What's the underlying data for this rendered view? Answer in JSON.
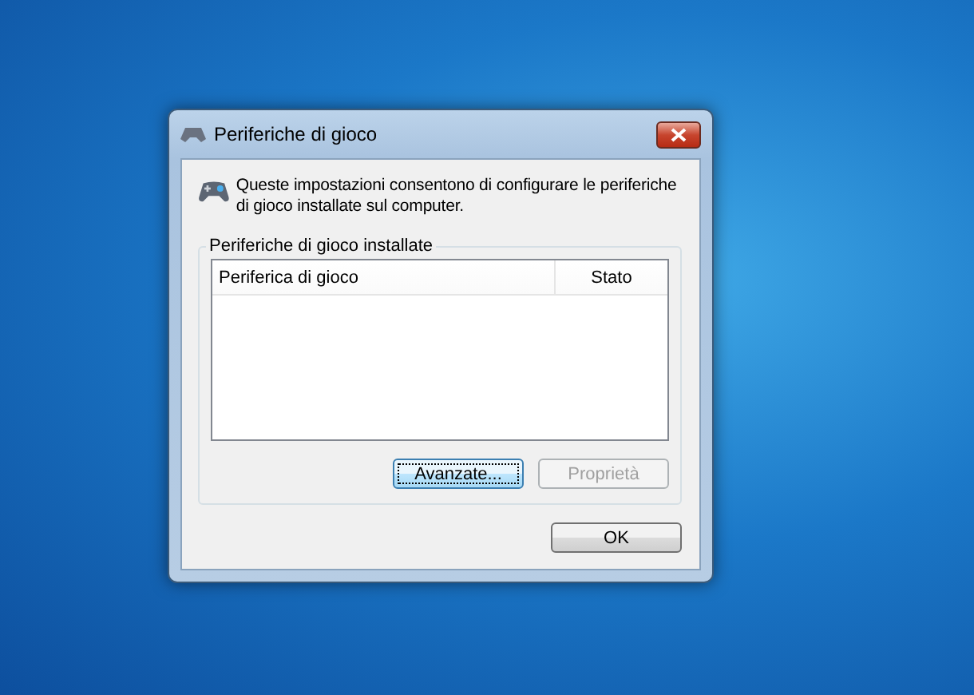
{
  "window": {
    "title": "Periferiche di gioco"
  },
  "description": "Queste impostazioni consentono di configurare le periferiche di gioco installate sul computer.",
  "group": {
    "title": "Periferiche di gioco installate",
    "table": {
      "columns": [
        "Periferica di gioco",
        "Stato"
      ]
    },
    "buttons": [
      {
        "label": "Avanzate...",
        "disabled": false,
        "focused": true
      },
      {
        "label": "Proprietà",
        "disabled": true,
        "focused": false
      }
    ]
  },
  "buttons": [
    {
      "label": "OK",
      "disabled": false,
      "focused": false
    }
  ]
}
